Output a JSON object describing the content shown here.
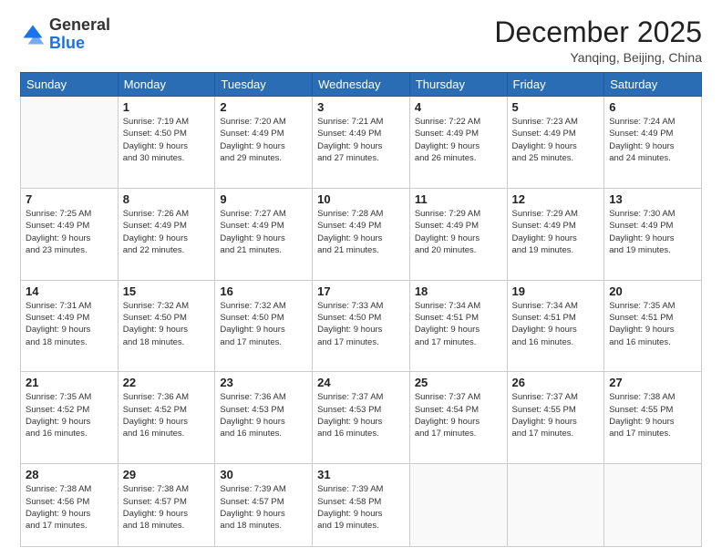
{
  "header": {
    "logo": {
      "general": "General",
      "blue": "Blue"
    },
    "title": "December 2025",
    "location": "Yanqing, Beijing, China"
  },
  "calendar": {
    "days_of_week": [
      "Sunday",
      "Monday",
      "Tuesday",
      "Wednesday",
      "Thursday",
      "Friday",
      "Saturday"
    ],
    "weeks": [
      [
        {
          "day": "",
          "info": ""
        },
        {
          "day": "1",
          "info": "Sunrise: 7:19 AM\nSunset: 4:50 PM\nDaylight: 9 hours\nand 30 minutes."
        },
        {
          "day": "2",
          "info": "Sunrise: 7:20 AM\nSunset: 4:49 PM\nDaylight: 9 hours\nand 29 minutes."
        },
        {
          "day": "3",
          "info": "Sunrise: 7:21 AM\nSunset: 4:49 PM\nDaylight: 9 hours\nand 27 minutes."
        },
        {
          "day": "4",
          "info": "Sunrise: 7:22 AM\nSunset: 4:49 PM\nDaylight: 9 hours\nand 26 minutes."
        },
        {
          "day": "5",
          "info": "Sunrise: 7:23 AM\nSunset: 4:49 PM\nDaylight: 9 hours\nand 25 minutes."
        },
        {
          "day": "6",
          "info": "Sunrise: 7:24 AM\nSunset: 4:49 PM\nDaylight: 9 hours\nand 24 minutes."
        }
      ],
      [
        {
          "day": "7",
          "info": "Sunrise: 7:25 AM\nSunset: 4:49 PM\nDaylight: 9 hours\nand 23 minutes."
        },
        {
          "day": "8",
          "info": "Sunrise: 7:26 AM\nSunset: 4:49 PM\nDaylight: 9 hours\nand 22 minutes."
        },
        {
          "day": "9",
          "info": "Sunrise: 7:27 AM\nSunset: 4:49 PM\nDaylight: 9 hours\nand 21 minutes."
        },
        {
          "day": "10",
          "info": "Sunrise: 7:28 AM\nSunset: 4:49 PM\nDaylight: 9 hours\nand 21 minutes."
        },
        {
          "day": "11",
          "info": "Sunrise: 7:29 AM\nSunset: 4:49 PM\nDaylight: 9 hours\nand 20 minutes."
        },
        {
          "day": "12",
          "info": "Sunrise: 7:29 AM\nSunset: 4:49 PM\nDaylight: 9 hours\nand 19 minutes."
        },
        {
          "day": "13",
          "info": "Sunrise: 7:30 AM\nSunset: 4:49 PM\nDaylight: 9 hours\nand 19 minutes."
        }
      ],
      [
        {
          "day": "14",
          "info": "Sunrise: 7:31 AM\nSunset: 4:49 PM\nDaylight: 9 hours\nand 18 minutes."
        },
        {
          "day": "15",
          "info": "Sunrise: 7:32 AM\nSunset: 4:50 PM\nDaylight: 9 hours\nand 18 minutes."
        },
        {
          "day": "16",
          "info": "Sunrise: 7:32 AM\nSunset: 4:50 PM\nDaylight: 9 hours\nand 17 minutes."
        },
        {
          "day": "17",
          "info": "Sunrise: 7:33 AM\nSunset: 4:50 PM\nDaylight: 9 hours\nand 17 minutes."
        },
        {
          "day": "18",
          "info": "Sunrise: 7:34 AM\nSunset: 4:51 PM\nDaylight: 9 hours\nand 17 minutes."
        },
        {
          "day": "19",
          "info": "Sunrise: 7:34 AM\nSunset: 4:51 PM\nDaylight: 9 hours\nand 16 minutes."
        },
        {
          "day": "20",
          "info": "Sunrise: 7:35 AM\nSunset: 4:51 PM\nDaylight: 9 hours\nand 16 minutes."
        }
      ],
      [
        {
          "day": "21",
          "info": "Sunrise: 7:35 AM\nSunset: 4:52 PM\nDaylight: 9 hours\nand 16 minutes."
        },
        {
          "day": "22",
          "info": "Sunrise: 7:36 AM\nSunset: 4:52 PM\nDaylight: 9 hours\nand 16 minutes."
        },
        {
          "day": "23",
          "info": "Sunrise: 7:36 AM\nSunset: 4:53 PM\nDaylight: 9 hours\nand 16 minutes."
        },
        {
          "day": "24",
          "info": "Sunrise: 7:37 AM\nSunset: 4:53 PM\nDaylight: 9 hours\nand 16 minutes."
        },
        {
          "day": "25",
          "info": "Sunrise: 7:37 AM\nSunset: 4:54 PM\nDaylight: 9 hours\nand 17 minutes."
        },
        {
          "day": "26",
          "info": "Sunrise: 7:37 AM\nSunset: 4:55 PM\nDaylight: 9 hours\nand 17 minutes."
        },
        {
          "day": "27",
          "info": "Sunrise: 7:38 AM\nSunset: 4:55 PM\nDaylight: 9 hours\nand 17 minutes."
        }
      ],
      [
        {
          "day": "28",
          "info": "Sunrise: 7:38 AM\nSunset: 4:56 PM\nDaylight: 9 hours\nand 17 minutes."
        },
        {
          "day": "29",
          "info": "Sunrise: 7:38 AM\nSunset: 4:57 PM\nDaylight: 9 hours\nand 18 minutes."
        },
        {
          "day": "30",
          "info": "Sunrise: 7:39 AM\nSunset: 4:57 PM\nDaylight: 9 hours\nand 18 minutes."
        },
        {
          "day": "31",
          "info": "Sunrise: 7:39 AM\nSunset: 4:58 PM\nDaylight: 9 hours\nand 19 minutes."
        },
        {
          "day": "",
          "info": ""
        },
        {
          "day": "",
          "info": ""
        },
        {
          "day": "",
          "info": ""
        }
      ]
    ]
  }
}
